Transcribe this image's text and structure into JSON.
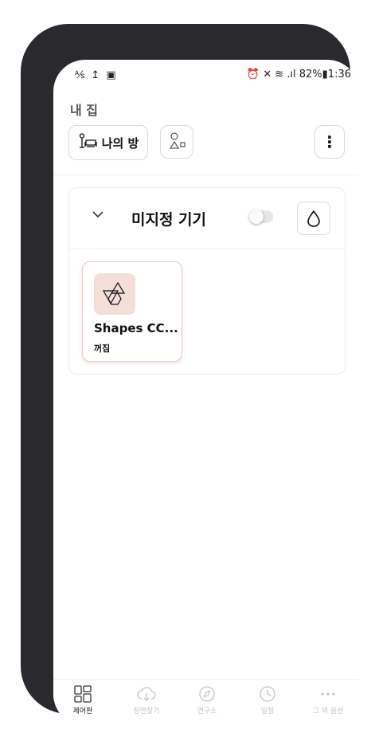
{
  "status_bar": {
    "left_icons": "⅍ ↥ ▣",
    "right_text": "82%▮1:36",
    "signal": "⏰ ✕ ≋ .ıl"
  },
  "header": {
    "home_title": "내 집",
    "room_label": "나의 방"
  },
  "group": {
    "name": "미지정 기기",
    "toggle_on": false
  },
  "device": {
    "name": "Shapes CC...",
    "status": "꺼짐"
  },
  "bottom_nav": [
    {
      "label": "제어판",
      "icon": "dashboard-icon"
    },
    {
      "label": "장면찾기",
      "icon": "download-cloud-icon"
    },
    {
      "label": "연구소",
      "icon": "compass-icon"
    },
    {
      "label": "일정",
      "icon": "clock-icon"
    },
    {
      "label": "그 외 옵션",
      "icon": "more-dots-icon"
    }
  ],
  "colors": {
    "phone_frame": "#2a2a2e",
    "device_icon_bg": "#f5ddd8",
    "inactive_nav": "#c4c4c4"
  }
}
